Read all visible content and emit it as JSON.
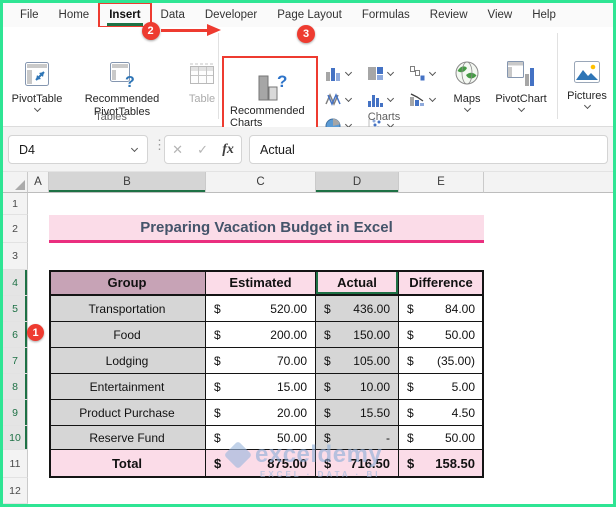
{
  "menu": {
    "tabs": [
      "File",
      "Home",
      "Insert",
      "Data",
      "Developer",
      "Page Layout",
      "Formulas",
      "Review",
      "View",
      "Help"
    ],
    "active_tab": "Insert"
  },
  "ribbon": {
    "tables_group": {
      "group_label": "Tables",
      "pivottable_label": "PivotTable",
      "recommended_pivottables_label": "Recommended PivotTables",
      "table_label": "Table"
    },
    "charts_group": {
      "group_label": "Charts",
      "recommended_charts_label": "Recommended Charts",
      "maps_label": "Maps",
      "pivotchart_label": "PivotChart",
      "mini_icons": [
        "column-chart",
        "hierarchy-chart",
        "waterfall-chart",
        "line-chart",
        "histogram-chart",
        "combo-chart",
        "pie-chart",
        "scatter-chart"
      ]
    },
    "illustrations_group": {
      "pictures_label": "Pictures"
    }
  },
  "formula_bar": {
    "name_box": "D4",
    "formula": "Actual",
    "cancel": "✕",
    "enter": "✓",
    "fx": "fx"
  },
  "annotations": {
    "step1": "1",
    "step2": "2",
    "step3": "3",
    "highlight_color": "#ee3b30"
  },
  "sheet": {
    "column_headers": [
      "A",
      "B",
      "C",
      "D",
      "E"
    ],
    "selected_columns": [
      "B",
      "D"
    ],
    "row_headers": [
      "1",
      "2",
      "3",
      "4",
      "5",
      "6",
      "7",
      "8",
      "9",
      "10",
      "11",
      "12"
    ],
    "selected_rows": [
      "4",
      "5",
      "6",
      "7",
      "8",
      "9",
      "10"
    ],
    "active_cell": "D4",
    "title": "Preparing Vacation Budget in Excel",
    "table": {
      "headers": [
        "Group",
        "Estimated",
        "Actual",
        "Difference"
      ],
      "currency": "$",
      "rows": [
        {
          "group": "Transportation",
          "estimated": "520.00",
          "actual": "436.00",
          "difference": "84.00"
        },
        {
          "group": "Food",
          "estimated": "200.00",
          "actual": "150.00",
          "difference": "50.00"
        },
        {
          "group": "Lodging",
          "estimated": "70.00",
          "actual": "105.00",
          "difference": "(35.00)"
        },
        {
          "group": "Entertainment",
          "estimated": "15.00",
          "actual": "10.00",
          "difference": "5.00"
        },
        {
          "group": "Product Purchase",
          "estimated": "20.00",
          "actual": "15.50",
          "difference": "4.50"
        },
        {
          "group": "Reserve Fund",
          "estimated": "50.00",
          "actual": "-",
          "difference": "50.00"
        }
      ],
      "total": {
        "label": "Total",
        "estimated": "875.00",
        "actual": "716.50",
        "difference": "158.50"
      }
    },
    "colors": {
      "title_bg": "#fbdce8",
      "title_underline": "#ea2f7f",
      "header_mauve": "#c7a3b6",
      "header_pink": "#fbdce8",
      "cell_gray": "#d6d6d6",
      "selection_green": "#1e7145"
    }
  },
  "watermark": {
    "brand": "exceldemy",
    "tagline": "EXCEL · DATA · BI"
  }
}
